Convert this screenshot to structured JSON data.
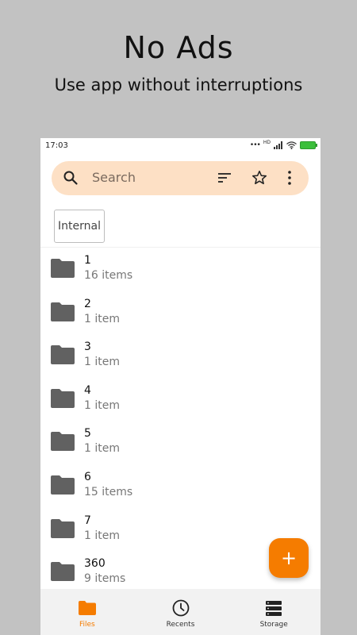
{
  "promo": {
    "title": "No Ads",
    "subtitle": "Use app without interruptions"
  },
  "status_bar": {
    "time": "17:03",
    "network_label": "HD",
    "icons": [
      "dots-icon",
      "signal-icon",
      "wifi-icon",
      "battery-charging-icon"
    ]
  },
  "search": {
    "placeholder": "Search",
    "actions": [
      "sort-icon",
      "star-icon",
      "more-vert-icon"
    ]
  },
  "storage_chip": {
    "label": "Internal"
  },
  "files": [
    {
      "name": "1",
      "count": "16 items"
    },
    {
      "name": "2",
      "count": "1 item"
    },
    {
      "name": "3",
      "count": "1 item"
    },
    {
      "name": "4",
      "count": "1 item"
    },
    {
      "name": "5",
      "count": "1 item"
    },
    {
      "name": "6",
      "count": "15 items"
    },
    {
      "name": "7",
      "count": "1 item"
    },
    {
      "name": "360",
      "count": "9 items"
    }
  ],
  "fab": {
    "symbol": "+"
  },
  "bottom_nav": {
    "items": [
      {
        "label": "Files",
        "icon": "folder-icon",
        "active": true
      },
      {
        "label": "Recents",
        "icon": "clock-icon",
        "active": false
      },
      {
        "label": "Storage",
        "icon": "storage-icon",
        "active": false
      }
    ]
  },
  "colors": {
    "accent": "#f57c00",
    "search_bg": "#fde0c5",
    "page_bg": "#c2c2c2",
    "folder": "#616161"
  }
}
